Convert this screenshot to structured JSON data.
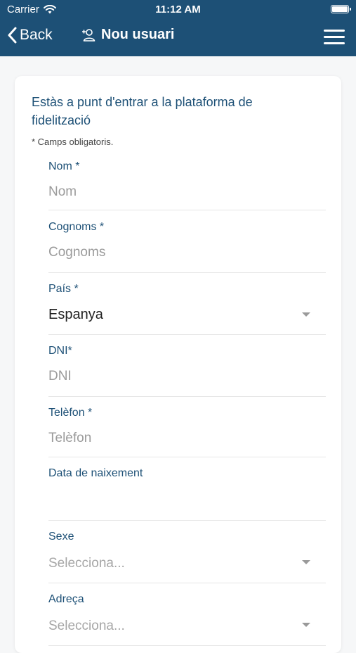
{
  "status_bar": {
    "carrier": "Carrier",
    "time": "11:12 AM"
  },
  "nav": {
    "back_label": "Back",
    "title": "Nou usuari"
  },
  "form": {
    "intro": "Estàs a punt d'entrar a la plataforma de fidelització",
    "required_note": "* Camps obligatoris.",
    "fields": {
      "nom": {
        "label": "Nom *",
        "placeholder": "Nom"
      },
      "cognoms": {
        "label": "Cognoms *",
        "placeholder": "Cognoms"
      },
      "pais": {
        "label": "País *",
        "value": "Espanya"
      },
      "dni": {
        "label": "DNI*",
        "placeholder": "DNI"
      },
      "telefon": {
        "label": "Telèfon *",
        "placeholder": "Telèfon"
      },
      "data_naixement": {
        "label": "Data de naixement"
      },
      "sexe": {
        "label": "Sexe",
        "placeholder": "Selecciona..."
      },
      "adreca": {
        "label": "Adreça",
        "placeholder": "Selecciona..."
      }
    }
  }
}
